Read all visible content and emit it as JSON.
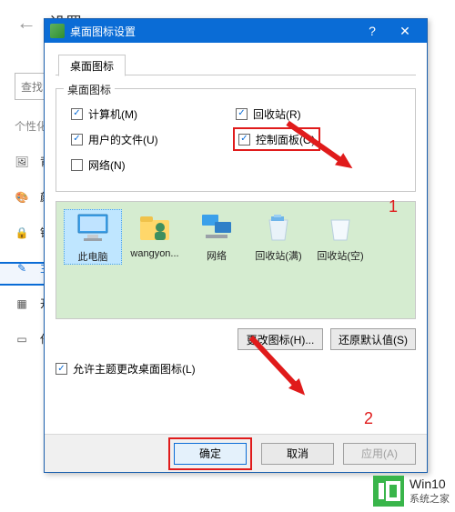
{
  "background": {
    "back_icon": "←",
    "title": "设置",
    "search_placeholder": "查找",
    "category": "个性化",
    "items": [
      {
        "icon": "background",
        "label": "背"
      },
      {
        "icon": "color",
        "label": "颜"
      },
      {
        "icon": "lock",
        "label": "锁"
      },
      {
        "icon": "theme",
        "label": "主",
        "selected": true
      },
      {
        "icon": "start",
        "label": "开"
      },
      {
        "icon": "taskbar",
        "label": "任"
      }
    ]
  },
  "dialog": {
    "title": "桌面图标设置",
    "tab": "桌面图标",
    "group_legend": "桌面图标",
    "checkboxes": {
      "computer": {
        "label": "计算机(M)",
        "checked": true
      },
      "recycle": {
        "label": "回收站(R)",
        "checked": true
      },
      "userfiles": {
        "label": "用户的文件(U)",
        "checked": true
      },
      "control": {
        "label": "控制面板(O)",
        "checked": true
      },
      "network": {
        "label": "网络(N)",
        "checked": false
      }
    },
    "icons": [
      {
        "name": "此电脑",
        "kind": "pc",
        "selected": true
      },
      {
        "name": "wangyon...",
        "kind": "user"
      },
      {
        "name": "网络",
        "kind": "net"
      },
      {
        "name": "回收站(满)",
        "kind": "bin-full"
      },
      {
        "name": "回收站(空)",
        "kind": "bin-empty"
      }
    ],
    "change_icon": "更改图标(H)...",
    "restore": "还原默认值(S)",
    "allow_theme": "允许主题更改桌面图标(L)",
    "ok": "确定",
    "cancel": "取消",
    "apply": "应用(A)"
  },
  "annotations": {
    "n1": "1",
    "n2": "2"
  },
  "watermark": {
    "logo": "I▢",
    "line1": "Win10",
    "line2": "系统之家"
  }
}
